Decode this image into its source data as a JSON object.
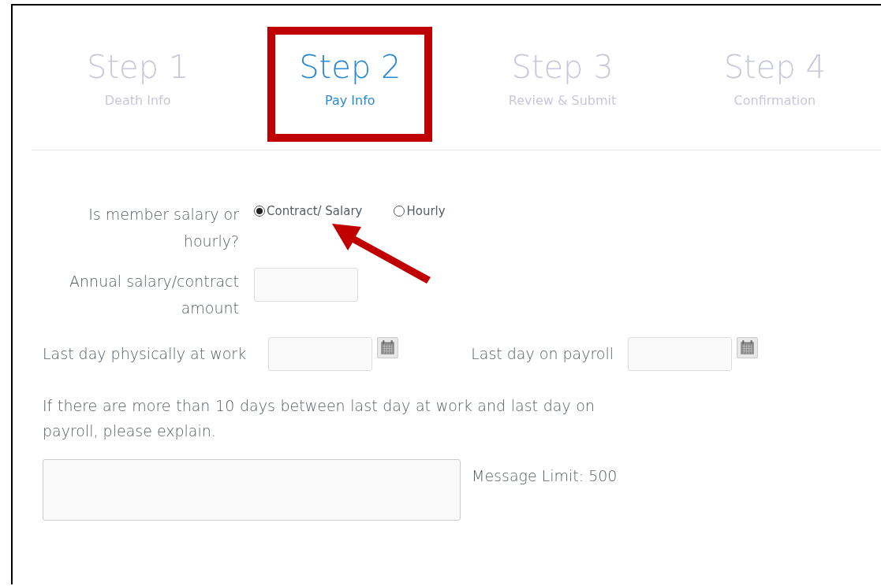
{
  "steps": [
    {
      "title": "Step 1",
      "subtitle": "Death Info",
      "selected": false
    },
    {
      "title": "Step 2",
      "subtitle": "Pay Info",
      "selected": true
    },
    {
      "title": "Step 3",
      "subtitle": "Review & Submit",
      "selected": false
    },
    {
      "title": "Step 4",
      "subtitle": "Confirmation",
      "selected": false
    }
  ],
  "pay_type": {
    "label": "Is member salary or hourly?",
    "options": [
      {
        "label": "Contract/ Salary",
        "selected": true
      },
      {
        "label": "Hourly",
        "selected": false
      }
    ]
  },
  "salary": {
    "label": "Annual salary/contract amount"
  },
  "last_day_work": {
    "label": "Last day physically at work"
  },
  "last_day_payroll": {
    "label": "Last day on payroll"
  },
  "explain": {
    "label": "If there are more than 10 days between last day at work and last day on payroll, please explain.",
    "limit": "Message Limit: 500"
  }
}
